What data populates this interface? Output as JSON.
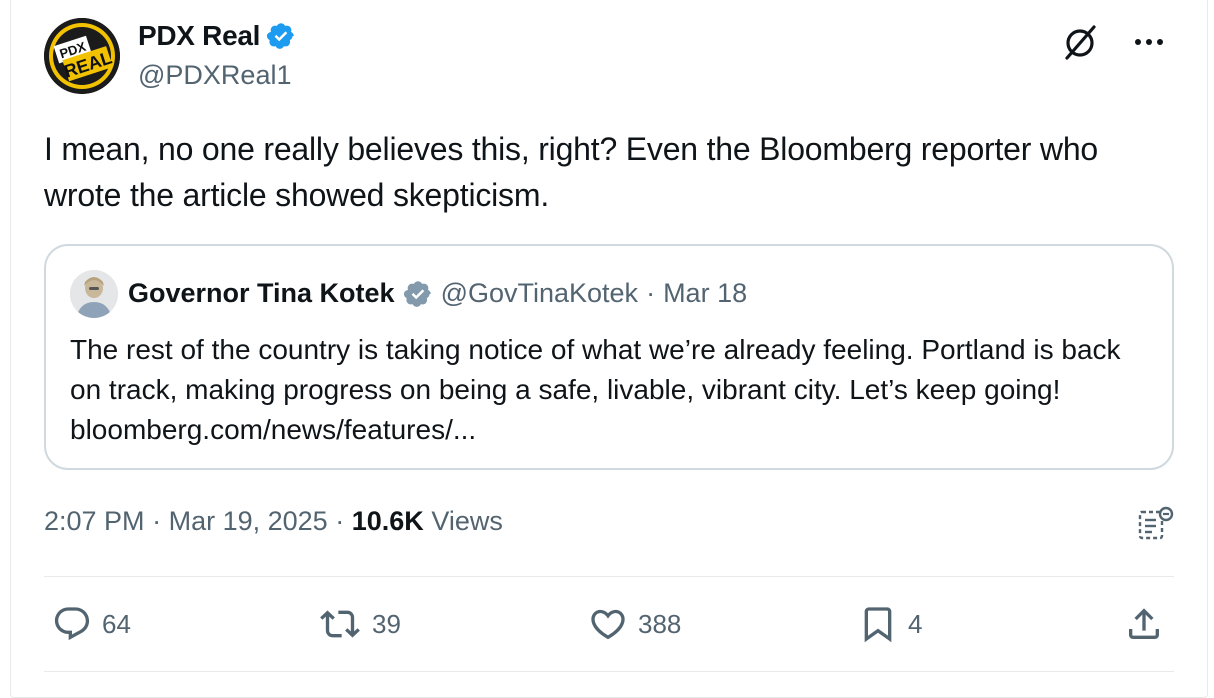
{
  "author": {
    "display_name": "PDX Real",
    "handle": "@PDXReal1",
    "avatar_text_top": "PDX",
    "avatar_text_bottom": "REAL"
  },
  "tweet": {
    "text": "I mean, no one really believes this, right? Even the Bloomberg reporter who wrote the article showed skepticism."
  },
  "quoted": {
    "display_name": "Governor Tina Kotek",
    "handle": "@GovTinaKotek",
    "separator": "·",
    "date": "Mar 18",
    "text": "The rest of the country is taking notice of what we’re already feeling. Portland is back on track, making progress on being a safe, livable, vibrant city. Let’s keep going! bloomberg.com/news/features/..."
  },
  "meta": {
    "time": "2:07 PM",
    "separator": "·",
    "date": "Mar 19, 2025",
    "views_count": "10.6K",
    "views_label": "Views"
  },
  "actions": {
    "replies": "64",
    "reposts": "39",
    "likes": "388",
    "bookmarks": "4"
  },
  "icons": {
    "verified_color": "#1d9bf0",
    "gov_badge_color": "#829aab",
    "secondary_text": "#536471"
  }
}
